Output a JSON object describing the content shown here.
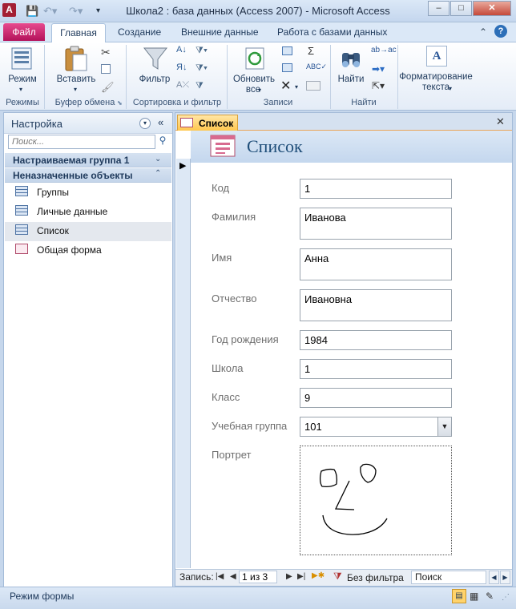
{
  "window": {
    "title": "Школа2 : база данных (Access 2007)  -  Microsoft Access",
    "min_label": "–",
    "max_label": "□",
    "close_label": "✕"
  },
  "ribbon": {
    "tabs": [
      "Файл",
      "Главная",
      "Создание",
      "Внешние данные",
      "Работа с базами данных"
    ],
    "groups": {
      "views": {
        "label": "Режимы",
        "view_button": "Режим"
      },
      "clipboard": {
        "label": "Буфер обмена",
        "paste_button": "Вставить"
      },
      "sort_filter": {
        "label": "Сортировка и фильтр",
        "filter_button": "Фильтр"
      },
      "records": {
        "label": "Записи",
        "refresh_button": "Обновить",
        "refresh_sub": "все"
      },
      "find": {
        "label": "Найти",
        "find_button": "Найти"
      },
      "text": {
        "label": "",
        "format_button": "Форматирование",
        "format_sub": "текста"
      }
    }
  },
  "nav": {
    "title": "Настройка",
    "search_placeholder": "Поиск...",
    "groups": [
      "Настраиваемая группа 1",
      "Неназначенные объекты"
    ],
    "items": [
      "Группы",
      "Личные данные",
      "Список",
      "Общая форма"
    ]
  },
  "doc": {
    "tab_label": "Список",
    "form_title": "Список",
    "fields": [
      {
        "label": "Код",
        "value": "1"
      },
      {
        "label": "Фамилия",
        "value": "Иванова"
      },
      {
        "label": "Имя",
        "value": "Анна"
      },
      {
        "label": "Отчество",
        "value": "Ивановна"
      },
      {
        "label": "Год рождения",
        "value": "1984"
      },
      {
        "label": "Школа",
        "value": "1"
      },
      {
        "label": "Класс",
        "value": "9"
      },
      {
        "label": "Учебная группа",
        "value": "101"
      },
      {
        "label": "Портрет",
        "value": ""
      }
    ]
  },
  "record_nav": {
    "label": "Запись:",
    "position": "1 из 3",
    "filter_label": "Без фильтра",
    "search_label": "Поиск"
  },
  "status": {
    "text": "Режим формы"
  },
  "colors": {
    "file_tab": "#b3125a",
    "accent": "#1f4e79",
    "doc_tab": "#ffc74e"
  }
}
